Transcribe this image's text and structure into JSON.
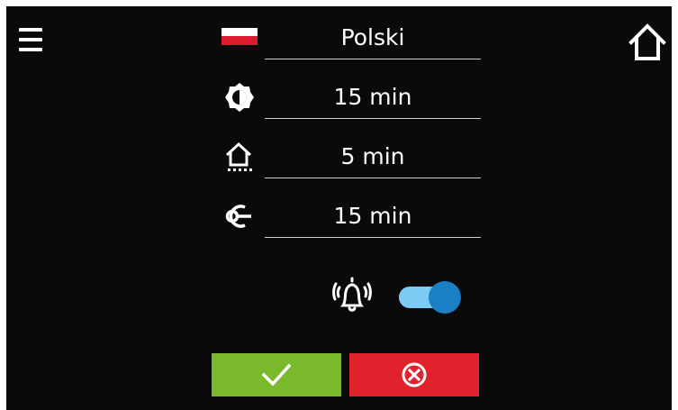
{
  "settings": {
    "language": {
      "value": "Polski",
      "flag_colors": [
        "#ffffff",
        "#dc1c2e"
      ]
    },
    "brightness": {
      "value": "15 min",
      "icon": "brightness-icon"
    },
    "home_return": {
      "value": "5 min",
      "icon": "home-timer-icon"
    },
    "logout": {
      "value": "15 min",
      "icon": "logout-key-icon"
    }
  },
  "alarm": {
    "icon": "alarm-bell-icon",
    "enabled": true
  },
  "toolbar": {
    "menu_icon": "hamburger-menu-icon",
    "home_icon": "home-icon"
  },
  "actions": {
    "confirm_icon": "checkmark-icon",
    "cancel_icon": "cancel-x-circle-icon"
  },
  "colors": {
    "background": "#0a0a0a",
    "confirm": "#7ab92c",
    "cancel": "#e0232d",
    "toggle_track": "#7dcbf4",
    "toggle_knob": "#1b7fc3"
  }
}
